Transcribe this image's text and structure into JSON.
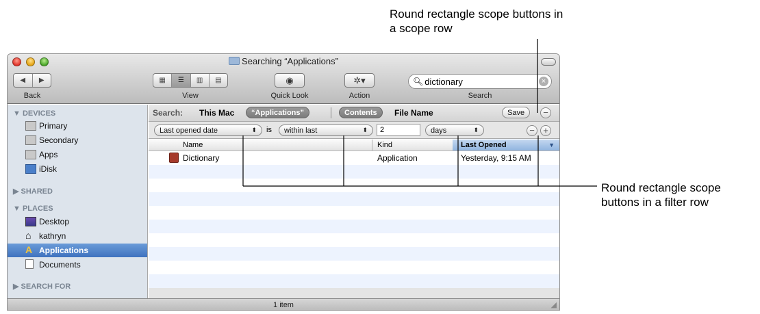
{
  "callouts": {
    "top": "Round rectangle scope buttons in a scope row",
    "right": "Round rectangle scope buttons in a filter row"
  },
  "window": {
    "title": "Searching “Applications”",
    "status": "1 item"
  },
  "toolbar": {
    "back_label": "Back",
    "view_label": "View",
    "quicklook_label": "Quick Look",
    "action_label": "Action",
    "search_label": "Search",
    "search_value": "dictionary"
  },
  "sidebar": {
    "devices_header": "DEVICES",
    "devices": [
      "Primary",
      "Secondary",
      "Apps",
      "iDisk"
    ],
    "shared_header": "SHARED",
    "places_header": "PLACES",
    "places": [
      "Desktop",
      "kathryn",
      "Applications",
      "Documents"
    ],
    "searchfor_header": "SEARCH FOR"
  },
  "scope": {
    "label": "Search:",
    "this_mac": "This Mac",
    "applications": "“Applications”",
    "contents": "Contents",
    "file_name": "File Name",
    "save": "Save"
  },
  "filter": {
    "attribute": "Last opened date",
    "is": "is",
    "operator": "within last",
    "value": "2",
    "unit": "days"
  },
  "columns": {
    "name": "Name",
    "kind": "Kind",
    "last_opened": "Last Opened"
  },
  "rows": [
    {
      "name": "Dictionary",
      "kind": "Application",
      "last_opened": "Yesterday, 9:15 AM"
    }
  ],
  "colors": {
    "selection": "#3f72bf",
    "sidebar_bg": "#dde4ec",
    "alt_row": "#edf3fe"
  }
}
